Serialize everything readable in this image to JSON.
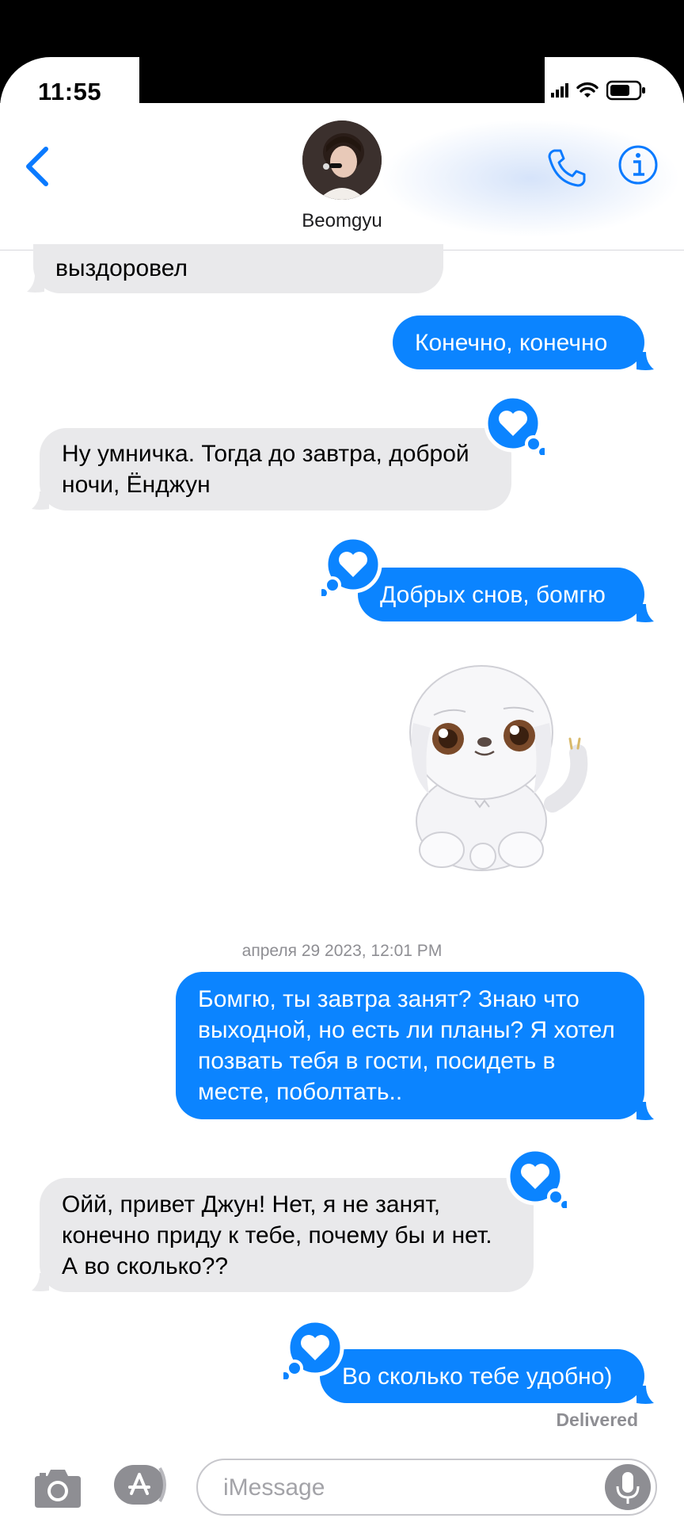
{
  "status_bar": {
    "time": "11:55"
  },
  "header": {
    "contact_name": "Beomgyu"
  },
  "messages": [
    {
      "dir": "in",
      "text": "выздоровел",
      "partial": true
    },
    {
      "dir": "out",
      "text": "Конечно, конечно"
    },
    {
      "dir": "in",
      "text": "Ну умничка. Тогда до завтра, доброй ночи, Ёнджун",
      "reaction": "heart"
    },
    {
      "dir": "out",
      "text": "Добрых снов, бомгю",
      "reaction": "heart"
    },
    {
      "dir": "out",
      "type": "sticker",
      "sticker": "white-puppy-sticker"
    },
    {
      "dir": "out",
      "text": "Бомгю, ты завтра занят? Знаю что выходной, но есть ли планы? Я хотел позвать тебя в гости, посидеть в месте, поболтать.."
    },
    {
      "dir": "in",
      "text": "Ойй, привет Джун! Нет, я не занят, конечно приду к тебе, почему бы и нет. А во сколько??",
      "reaction": "heart"
    },
    {
      "dir": "out",
      "text": "Во сколько тебе удобно)",
      "reaction": "heart"
    }
  ],
  "timestamp": "апреля 29 2023, 12:01 PM",
  "delivered_label": "Delivered",
  "input": {
    "placeholder": "iMessage"
  },
  "colors": {
    "blue": "#0b84ff",
    "gray_bubble": "#e9e9eb",
    "accent": "#0a7aff"
  }
}
